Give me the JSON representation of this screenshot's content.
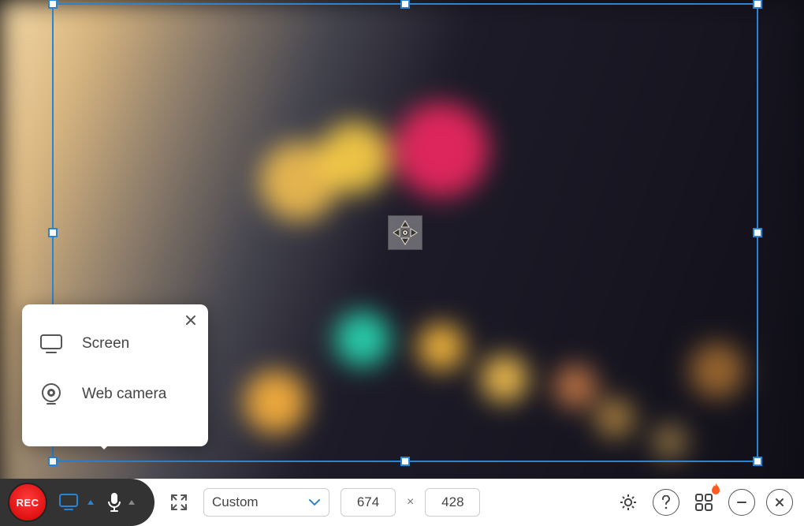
{
  "popup": {
    "items": [
      {
        "label": "Screen"
      },
      {
        "label": "Web camera"
      }
    ]
  },
  "toolbar": {
    "rec_label": "REC",
    "size_preset": "Custom",
    "width": "674",
    "height": "428",
    "times": "×"
  }
}
